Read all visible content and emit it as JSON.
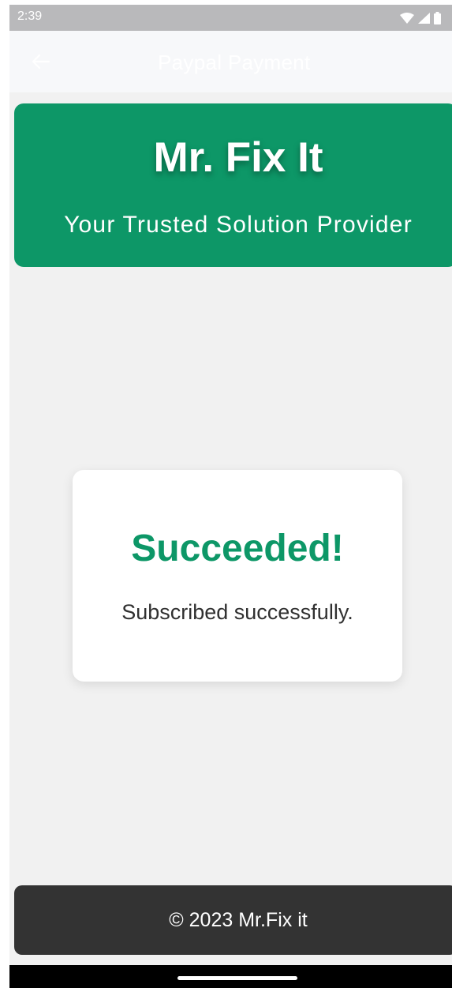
{
  "status_bar": {
    "time": "2:39",
    "icons": [
      "wifi-icon",
      "signal-icon",
      "battery-icon"
    ]
  },
  "app_bar": {
    "back_icon": "back-arrow-icon",
    "title": "Paypal Payment"
  },
  "header": {
    "title": "Mr. Fix It",
    "tagline": "Your Trusted Solution Provider"
  },
  "result": {
    "title": "Succeeded!",
    "message": "Subscribed successfully."
  },
  "footer": {
    "text": "© 2023 Mr.Fix it"
  },
  "colors": {
    "brand_green": "#0d9767",
    "footer_dark": "#333333",
    "background": "#f1f1f1"
  }
}
